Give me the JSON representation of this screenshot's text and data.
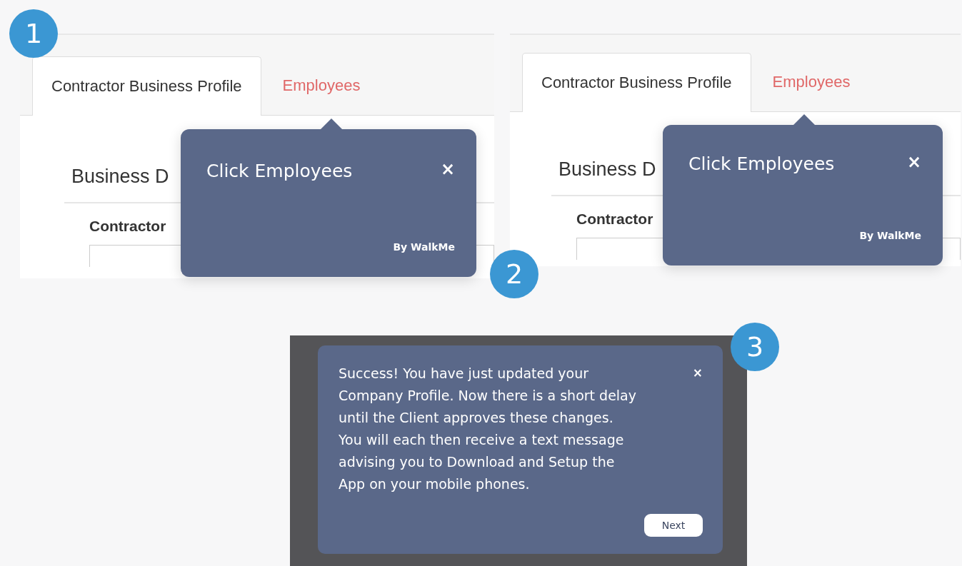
{
  "panels": [
    {
      "step": "1",
      "tabs": [
        {
          "label": "Contractor Business Profile",
          "selected": true
        },
        {
          "label": "Employees",
          "selected": false
        }
      ],
      "heading": "Business D",
      "field_label": "Contractor",
      "tooltip": {
        "title": "Click Employees",
        "close": "×",
        "footer": "By WalkMe"
      }
    },
    {
      "step": "2",
      "tabs": [
        {
          "label": "Contractor Business Profile",
          "selected": true
        },
        {
          "label": "Employees",
          "selected": false
        }
      ],
      "heading": "Business D",
      "field_label": "Contractor",
      "tooltip": {
        "title": "Click Employees",
        "close": "×",
        "footer": "By WalkMe"
      }
    }
  ],
  "final": {
    "step": "3",
    "dialog": {
      "message": "Success! You have just updated your\nCompany Profile. Now there is a short delay\nuntil the Client approves these changes.\nYou will each then receive a text message\nadvising you to Download and Setup the\nApp on your mobile phones.",
      "close": "×",
      "button": "Next"
    }
  }
}
